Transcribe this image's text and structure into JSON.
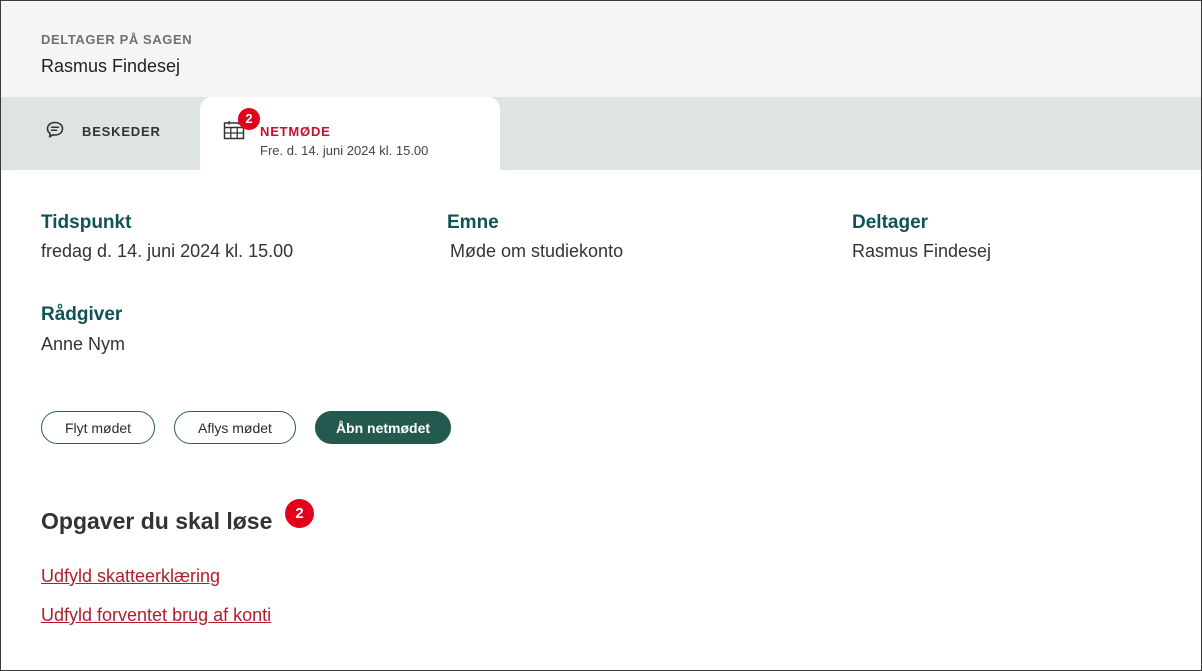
{
  "case": {
    "label": "DELTAGER PÅ SAGEN",
    "participant_name": "Rasmus Findesej"
  },
  "tabs": {
    "messages": {
      "icon": "chat-bubble-icon",
      "label": "BESKEDER"
    },
    "meeting": {
      "icon": "calendar-icon",
      "badge": "2",
      "label": "NETMØDE",
      "sublabel": "Fre. d. 14. juni 2024 kl. 15.00"
    }
  },
  "details": {
    "time": {
      "label": "Tidspunkt",
      "value": "fredag d. 14. juni 2024 kl. 15.00"
    },
    "subject": {
      "label": "Emne",
      "value": "Møde om studiekonto"
    },
    "participant": {
      "label": "Deltager",
      "value": "Rasmus Findesej"
    },
    "advisor": {
      "label": "Rådgiver",
      "value": "Anne Nym"
    }
  },
  "actions": {
    "move": "Flyt mødet",
    "cancel": "Aflys mødet",
    "open": "Åbn netmødet"
  },
  "tasks": {
    "heading": "Opgaver du skal løse",
    "badge": "2",
    "items": [
      "Udfyld skatteerklæring",
      "Udfyld forventet brug af konti"
    ]
  },
  "colors": {
    "accent_teal": "#0f5257",
    "primary_button": "#23594f",
    "alert_red": "#e3001b",
    "link_red": "#b01e2c",
    "tab_bar": "#dde4e3"
  }
}
